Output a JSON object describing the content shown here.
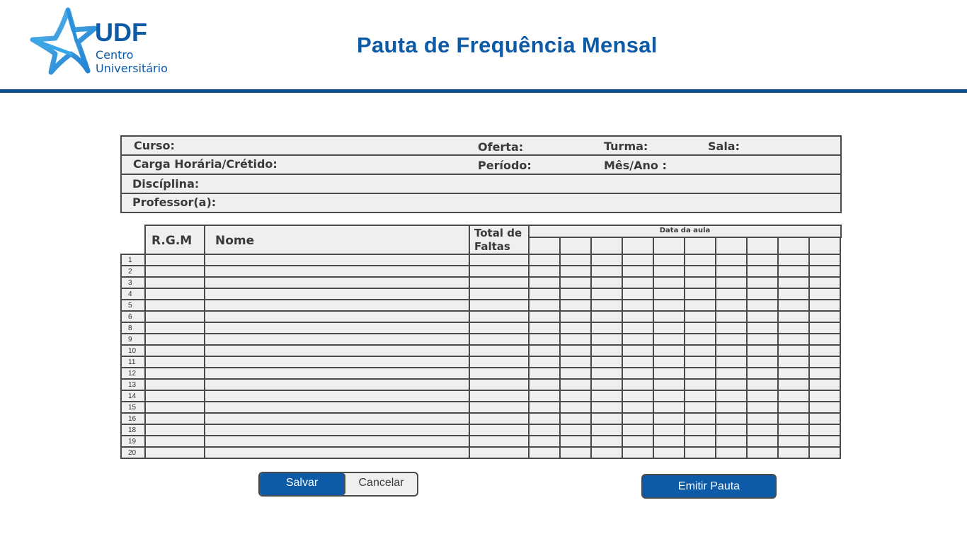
{
  "header": {
    "logo": {
      "brand": "UDF",
      "line1": "Centro",
      "line2": "Universitário",
      "icon": "star-logo-icon"
    },
    "title": "Pauta de Frequência Mensal"
  },
  "info": {
    "curso": "Curso:",
    "oferta": "Oferta:",
    "turma": "Turma:",
    "sala": "Sala:",
    "carga": "Carga Horária/Crétido:",
    "periodo": "Período:",
    "mes_ano": "Mês/Ano :",
    "disciplina": "Discíplina:",
    "professor": "Professor(a):"
  },
  "table": {
    "headers": {
      "rgm": "R.G.M",
      "nome": "Nome",
      "total_line1": "Total de",
      "total_line2": "Faltas",
      "data_aula": "Data da aula"
    },
    "date_columns": 10,
    "row_numbers": [
      "1",
      "2",
      "3",
      "4",
      "5",
      "6",
      "8",
      "9",
      "10",
      "11",
      "12",
      "13",
      "14",
      "15",
      "16",
      "18",
      "19",
      "20"
    ]
  },
  "buttons": {
    "save": "Salvar",
    "cancel": "Cancelar",
    "emit": "Emitir Pauta"
  },
  "colors": {
    "brand_blue": "#0d5aa7",
    "rule": "#0f4e8c",
    "cell_bg": "#efefef",
    "border": "#4a4a4a"
  }
}
